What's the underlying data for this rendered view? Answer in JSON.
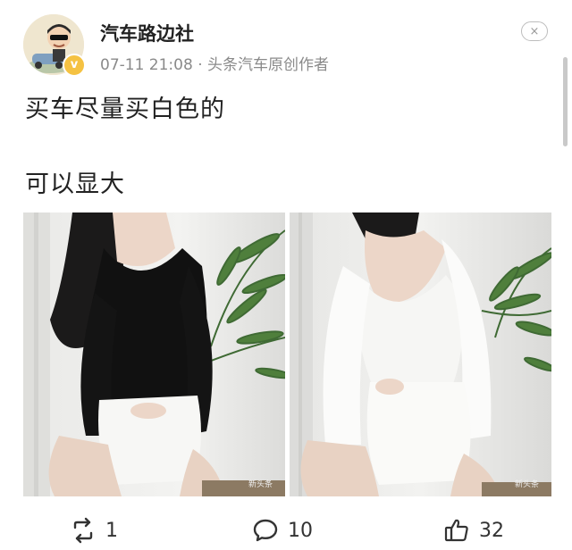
{
  "post": {
    "author": "汽车路边社",
    "verified_badge": "v",
    "time": "07-11 21:08",
    "separator": "·",
    "source": "头条汽车原创作者",
    "close_label": "×",
    "lines": [
      "买车尽量买白色的",
      "可以显大"
    ]
  },
  "images": [
    {
      "alt": "woman in black long-sleeve top and white shorts",
      "watermark": "新头条"
    },
    {
      "alt": "woman in white top and white shorts",
      "watermark": "新头条"
    }
  ],
  "actions": {
    "repost_count": "1",
    "comment_count": "10",
    "like_count": "32"
  },
  "colors": {
    "text": "#222222",
    "meta": "#8a8a8a",
    "badge": "#f5c242"
  }
}
